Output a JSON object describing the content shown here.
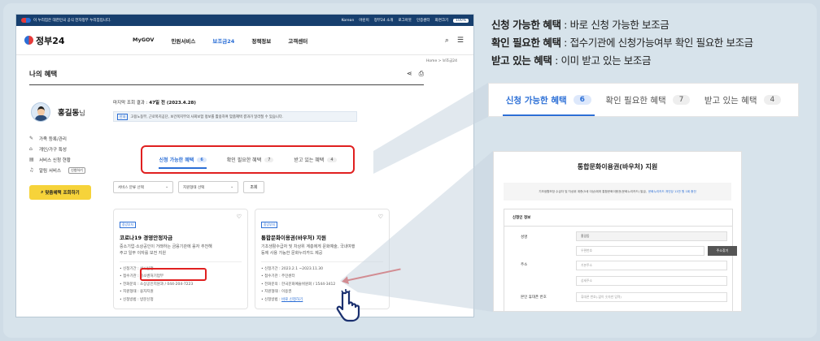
{
  "gov_bar": {
    "notice": "이 누리집은 대한민국 공식 전자정부 누리집입니다.",
    "language": "Korean",
    "items": [
      "어린이",
      "정부24 소개",
      "로그아웃",
      "인증센터",
      "화면크기"
    ],
    "zoom": "100%"
  },
  "header": {
    "logo": "정부24",
    "nav": [
      "MyGOV",
      "민원서비스",
      "보조금24",
      "정책정보",
      "고객센터"
    ],
    "active_nav": "보조금24"
  },
  "breadcrumb": "Home > 보조금24",
  "page": {
    "title": "나의 혜택"
  },
  "user": {
    "name": "홍길동",
    "suffix": "님"
  },
  "side_menu": [
    {
      "icon": "edit-icon",
      "label": "가족 등록/관리"
    },
    {
      "icon": "home-icon",
      "label": "개인/가구 특성"
    },
    {
      "icon": "list-icon",
      "label": "서비스 신청 현황"
    },
    {
      "icon": "bell-icon",
      "label": "알림 서비스",
      "tag": "신청하기"
    }
  ],
  "cta_label": "맞춤혜택 조회하기",
  "result": {
    "prefix": "마지막 조회 결과 :",
    "value": "47일 전 (2023.4.28)"
  },
  "notice": {
    "badge": "안내",
    "text": "고용노동부, 근로복지공단, 보건복지부의 사회보험 정보를 활용하여 맞춤혜택 결과가 달라질 수 있습니다."
  },
  "tabs": [
    {
      "label": "신청 가능한 혜택",
      "count": "6"
    },
    {
      "label": "확인 필요한 혜택",
      "count": "7"
    },
    {
      "label": "받고 있는 혜택",
      "count": "4"
    }
  ],
  "filters": {
    "category": "서비스 분류 선택",
    "status": "지원형태 선택",
    "search": "조회"
  },
  "cards": [
    {
      "category": "중앙부처",
      "title": "코로나19 경영안정자금",
      "desc": [
        "중소기업·소상공인이 거래하는 금융기관에 융자 추천해",
        "주고 일부 이자를 보전 지원"
      ],
      "items": [
        "신청기간 : 상시신청",
        "접수기관 : 중소벤처기업부",
        "전화문의 : 소상공인지원과 / 044-204-7223",
        "지원형태 : 융자지원",
        "신청방법 : 방문신청"
      ]
    },
    {
      "category": "중앙부처",
      "title": "통합문화이용권(바우처) 지원",
      "desc": [
        "기초생활수급자 및 차상위 계층에게 문화예술, 국내여행",
        "등에 사용 가능한 문화누리카드 제공"
      ],
      "items": [
        "신청기간 : 2023.2.1 ~2023.11.30",
        "접수기관 : 주민센터",
        "전화문의 : 한국문화예술위원회 / 1544-3412",
        "지원형태 : 이용권",
        "신청방법 :"
      ],
      "apply": "바로 신청하기"
    }
  ],
  "legend": [
    {
      "term": "신청 가능한 혜택",
      "sep": " : ",
      "desc": "바로 신청 가능한 보조금"
    },
    {
      "term": "확인 필요한 혜택",
      "sep": " : ",
      "desc": "접수기관에 신청가능여부 확인 필요한 보조금"
    },
    {
      "term": "받고 있는 혜택",
      "sep": " : ",
      "desc": "이미 받고 있는 보조금"
    }
  ],
  "zoom_tabs": [
    {
      "label": "신청 가능한 혜택",
      "count": "6"
    },
    {
      "label": "확인 필요한 혜택",
      "count": "7"
    },
    {
      "label": "받고 있는 혜택",
      "count": "4"
    }
  ],
  "detail": {
    "title": "통합문화이용권(바우처) 지원",
    "info": "기초생활보장 수급자 및 차상위 계층(5세 이상)에게 통합문화이용권(문화누리카드) 발급,",
    "info_link": "문화누리카드 개인당 11만 원 1회 충전",
    "section": "신청인 정보",
    "rows": [
      {
        "label": "성명",
        "field": "홍길동"
      },
      {
        "label": "주소",
        "field": "우편번호",
        "button": "주소찾기"
      },
      {
        "label": "",
        "field": "기본주소"
      },
      {
        "label": "",
        "field": "상세주소"
      },
      {
        "label": "본인 휴대폰 번호",
        "field": "휴대폰 번호(-없이 숫자만 입력)"
      }
    ]
  }
}
